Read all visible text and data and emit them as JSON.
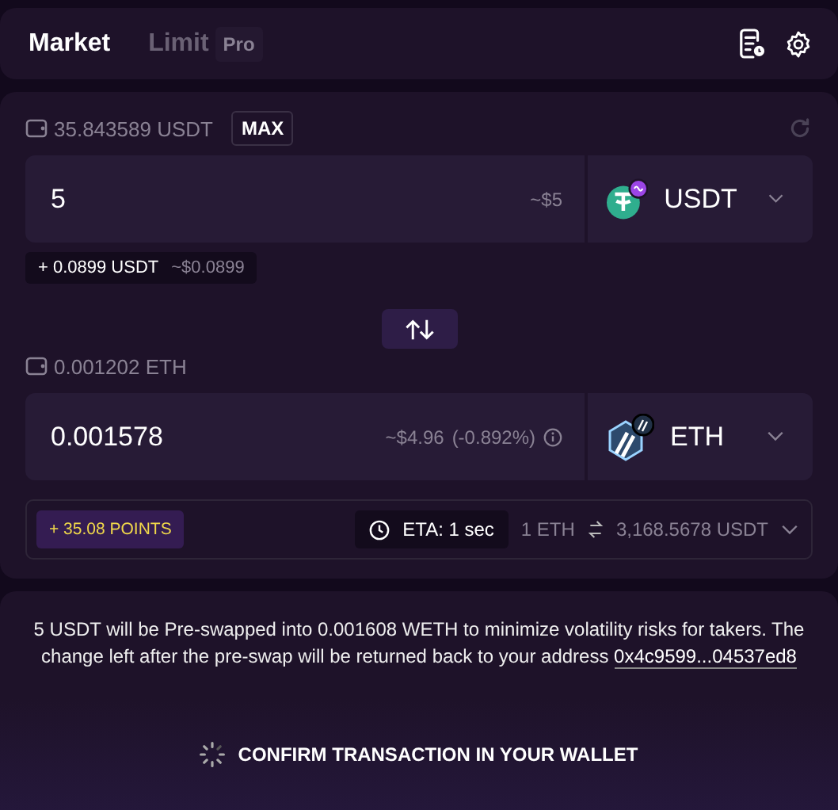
{
  "tabs": [
    {
      "label": "Market",
      "selected": true
    },
    {
      "label": "Limit",
      "badge": "Pro",
      "selected": false
    }
  ],
  "from": {
    "balance": "35.843589 USDT",
    "max_label": "MAX",
    "amount": "5",
    "usd": "~$5",
    "token": "USDT",
    "fee": "+ 0.0899 USDT",
    "fee_usd": "~$0.0899"
  },
  "to": {
    "balance": "0.001202 ETH",
    "amount": "0.001578",
    "usd": "~$4.96",
    "impact": "(-0.892%)",
    "token": "ETH"
  },
  "info": {
    "points": "+ 35.08 POINTS",
    "eta": "ETA: 1 sec",
    "rate_from": "1 ETH",
    "rate_to": "3,168.5678 USDT"
  },
  "notice": {
    "text": "5 USDT will be Pre-swapped into 0.001608 WETH to minimize volatility risks for takers. The change left after the pre-swap will be returned back to your address",
    "address": "0x4c9599...04537ed8"
  },
  "confirm": {
    "label": "CONFIRM TRANSACTION IN YOUR WALLET"
  }
}
